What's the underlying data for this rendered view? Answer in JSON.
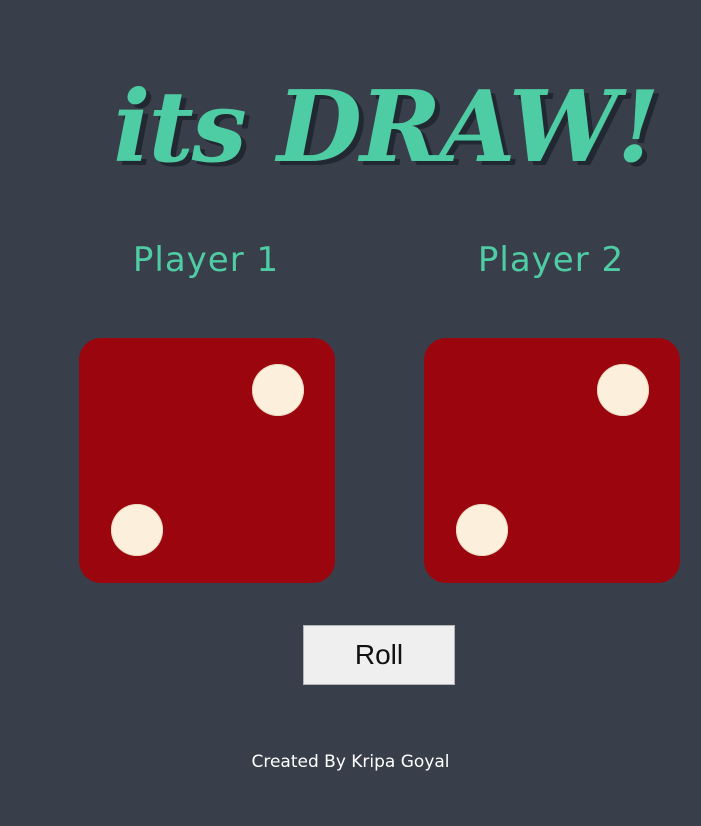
{
  "header": {
    "title": "its DRAW!"
  },
  "players": [
    {
      "label": "Player 1",
      "dice": {
        "value": 2,
        "icon": "dice-two-icon"
      }
    },
    {
      "label": "Player 2",
      "dice": {
        "value": 2,
        "icon": "dice-two-icon"
      }
    }
  ],
  "controls": {
    "roll_label": "Roll"
  },
  "footer": {
    "credit": "Created By Kripa Goyal"
  },
  "colors": {
    "background": "#393f4a",
    "accent": "#4ecca3",
    "title_shadow": "#222831",
    "dice": "#9b050e",
    "pip": "#fcf0dc",
    "button": "#efefef"
  }
}
